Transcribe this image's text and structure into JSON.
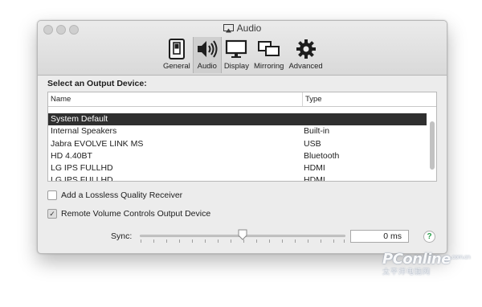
{
  "window": {
    "title": "Audio"
  },
  "toolbar": {
    "tabs": [
      {
        "label": "General",
        "icon": "general-switch-icon",
        "active": false
      },
      {
        "label": "Audio",
        "icon": "speaker-icon",
        "active": true
      },
      {
        "label": "Display",
        "icon": "monitor-icon",
        "active": false
      },
      {
        "label": "Mirroring",
        "icon": "mirroring-icon",
        "active": false
      },
      {
        "label": "Advanced",
        "icon": "gear-icon",
        "active": false
      }
    ]
  },
  "output": {
    "section_title": "Select an Output Device:",
    "columns": {
      "name": "Name",
      "type": "Type"
    },
    "rows": [
      {
        "name": "System Default",
        "type": ""
      },
      {
        "name": "Internal Speakers",
        "type": "Built-in"
      },
      {
        "name": "Jabra EVOLVE LINK MS",
        "type": "USB"
      },
      {
        "name": "HD 4.40BT",
        "type": "Bluetooth"
      },
      {
        "name": "LG IPS FULLHD",
        "type": "HDMI"
      },
      {
        "name": "LG IPS FULLHD",
        "type": "HDMI"
      }
    ],
    "selected_index": 0
  },
  "options": {
    "lossless_label": "Add a Lossless Quality Receiver",
    "lossless_checked": false,
    "remote_volume_label": "Remote Volume Controls Output Device",
    "remote_volume_checked": true
  },
  "sync": {
    "label": "Sync:",
    "value_text": "0 ms",
    "slider_fraction": 0.5
  },
  "help": {
    "glyph": "?"
  },
  "watermark": {
    "brand": "PConline",
    "dotcn": ".com.cn",
    "chinese": "太平洋电脑网"
  }
}
